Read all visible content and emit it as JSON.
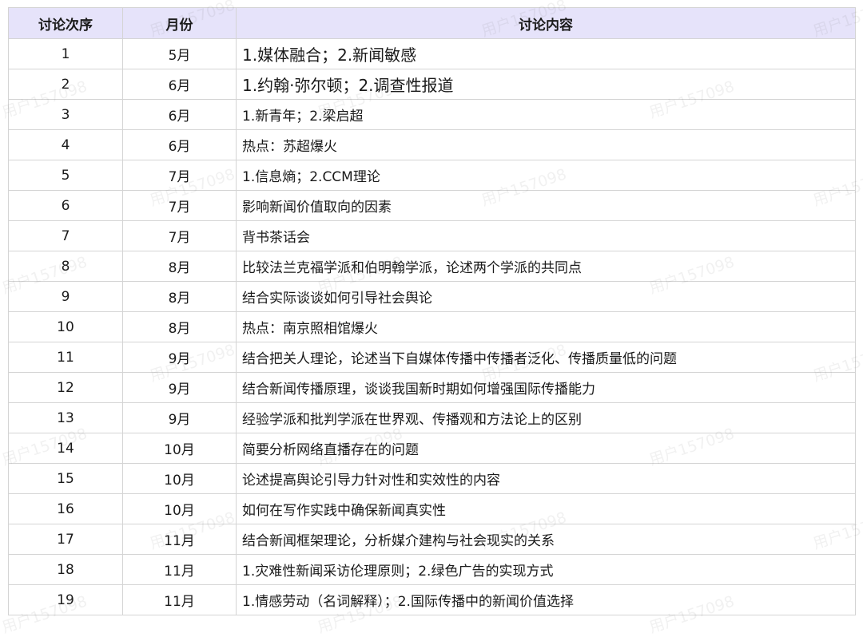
{
  "headers": [
    "讨论次序",
    "月份",
    "讨论内容"
  ],
  "rows": [
    {
      "n": "1",
      "month": "5月",
      "topic": "1.媒体融合；2.新闻敏感"
    },
    {
      "n": "2",
      "month": "6月",
      "topic": "1.约翰·弥尔顿；2.调查性报道"
    },
    {
      "n": "3",
      "month": "6月",
      "topic": "1.新青年；2.梁启超"
    },
    {
      "n": "4",
      "month": "6月",
      "topic": "热点：苏超爆火"
    },
    {
      "n": "5",
      "month": "7月",
      "topic": "1.信息熵；2.CCM理论"
    },
    {
      "n": "6",
      "month": "7月",
      "topic": "影响新闻价值取向的因素"
    },
    {
      "n": "7",
      "month": "7月",
      "topic": "背书茶话会"
    },
    {
      "n": "8",
      "month": "8月",
      "topic": "比较法兰克福学派和伯明翰学派，论述两个学派的共同点"
    },
    {
      "n": "9",
      "month": "8月",
      "topic": "结合实际谈谈如何引导社会舆论"
    },
    {
      "n": "10",
      "month": "8月",
      "topic": "热点：南京照相馆爆火"
    },
    {
      "n": "11",
      "month": "9月",
      "topic": "结合把关人理论，论述当下自媒体传播中传播者泛化、传播质量低的问题"
    },
    {
      "n": "12",
      "month": "9月",
      "topic": "结合新闻传播原理，谈谈我国新时期如何增强国际传播能力"
    },
    {
      "n": "13",
      "month": "9月",
      "topic": "经验学派和批判学派在世界观、传播观和方法论上的区别"
    },
    {
      "n": "14",
      "month": "10月",
      "topic": "简要分析网络直播存在的问题"
    },
    {
      "n": "15",
      "month": "10月",
      "topic": "论述提高舆论引导力针对性和实效性的内容"
    },
    {
      "n": "16",
      "month": "10月",
      "topic": "如何在写作实践中确保新闻真实性"
    },
    {
      "n": "17",
      "month": "11月",
      "topic": "结合新闻框架理论，分析媒介建构与社会现实的关系"
    },
    {
      "n": "18",
      "month": "11月",
      "topic": "1.灾难性新闻采访伦理原则；2.绿色广告的实现方式"
    },
    {
      "n": "19",
      "month": "11月",
      "topic": "1.情感劳动（名词解释）；2.国际传播中的新闻价值选择"
    }
  ],
  "watermark": "用户157098"
}
